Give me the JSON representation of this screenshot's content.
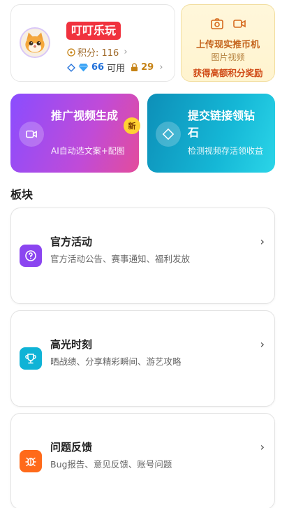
{
  "user": {
    "name": "叮叮乐玩",
    "points_label": "积分: 116",
    "diamonds": "66",
    "available_label": "可用",
    "locked": "29"
  },
  "upload": {
    "title": "上传现实推币机",
    "subtitle": "图片视频",
    "reward": "获得高额积分奖励"
  },
  "actions": [
    {
      "title": "推广视频生成",
      "subtitle": "AI自动选文案+配图",
      "badge": "新",
      "icon": "video-icon"
    },
    {
      "title": "提交链接领钻石",
      "subtitle": "检测视频存活领收益",
      "icon": "diamond-icon"
    }
  ],
  "section": {
    "title": "板块"
  },
  "boards": [
    {
      "title": "官方活动",
      "desc": "官方活动公告、赛事通知、福利发放",
      "icon": "question-icon",
      "color": "#8b45f0"
    },
    {
      "title": "高光时刻",
      "desc": "晒战绩、分享精彩瞬间、游艺攻略",
      "icon": "trophy-icon",
      "color": "#0fb3d6"
    },
    {
      "title": "问题反馈",
      "desc": "Bug报告、意见反馈、账号问题",
      "icon": "bug-icon",
      "color": "#ff6a1a"
    }
  ]
}
